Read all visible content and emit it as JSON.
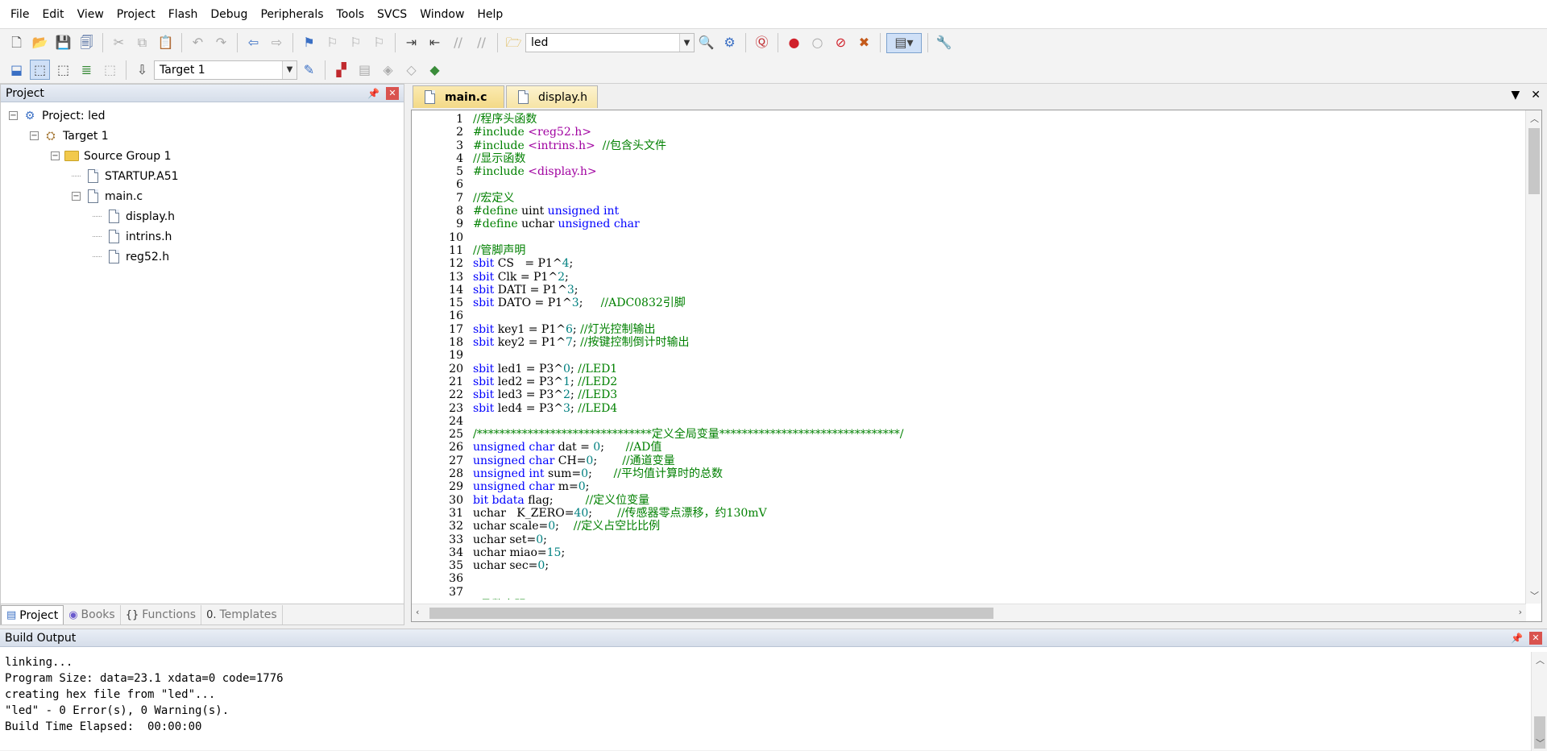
{
  "menu": [
    "File",
    "Edit",
    "View",
    "Project",
    "Flash",
    "Debug",
    "Peripherals",
    "Tools",
    "SVCS",
    "Window",
    "Help"
  ],
  "toolbar": {
    "find_value": "led",
    "target_value": "Target 1"
  },
  "project_panel": {
    "title": "Project",
    "tree": {
      "project": "Project: led",
      "target": "Target 1",
      "group": "Source Group 1",
      "file1": "STARTUP.A51",
      "file2": "main.c",
      "inc1": "display.h",
      "inc2": "intrins.h",
      "inc3": "reg52.h"
    },
    "tabs": [
      "Project",
      "Books",
      "Functions",
      "Templates"
    ]
  },
  "editor": {
    "tabs": [
      "main.c",
      "display.h"
    ],
    "lines": [
      "//程序头函数",
      "#include <reg52.h>",
      "#include <intrins.h>  //包含头文件",
      "//显示函数",
      "#include <display.h>",
      "",
      "//宏定义",
      "#define uint unsigned int",
      "#define uchar unsigned char",
      "",
      "//管脚声明",
      "sbit CS   = P1^4;",
      "sbit Clk = P1^2;",
      "sbit DATI = P1^3;",
      "sbit DATO = P1^3;     //ADC0832引脚",
      "",
      "sbit key1 = P1^6; //灯光控制输出",
      "sbit key2 = P1^7; //按键控制倒计时输出",
      "",
      "sbit led1 = P3^0; //LED1",
      "sbit led2 = P3^1; //LED2",
      "sbit led3 = P3^2; //LED3",
      "sbit led4 = P3^3; //LED4",
      "",
      "/*******************************定义全局变量********************************/",
      "unsigned char dat = 0;      //AD值",
      "unsigned char CH=0;       //通道变量",
      "unsigned int sum=0;      //平均值计算时的总数",
      "unsigned char m=0;",
      "bit bdata flag;         //定义位变量",
      "uchar   K_ZERO=40;       //传感器零点漂移，约130mV",
      "uchar scale=0;    //定义占空比比例",
      "uchar set=0;",
      "uchar miao=15;",
      "uchar sec=0;",
      "",
      "",
      "//函数声明"
    ]
  },
  "build_output": {
    "title": "Build Output",
    "text": "linking...\nProgram Size: data=23.1 xdata=0 code=1776\ncreating hex file from \"led\"...\n\"led\" - 0 Error(s), 0 Warning(s).\nBuild Time Elapsed:  00:00:00"
  },
  "colors": {
    "keyword": "#0000ff",
    "comment": "#008000",
    "include": "#a000a0",
    "number": "#008080"
  }
}
